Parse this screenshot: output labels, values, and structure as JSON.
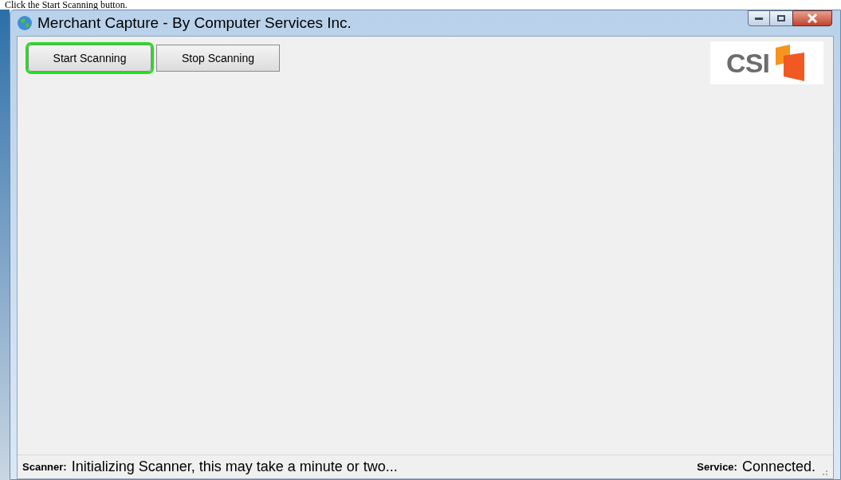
{
  "caption": "Click the Start Scanning button.",
  "window": {
    "title": "Merchant Capture - By Computer Services Inc."
  },
  "toolbar": {
    "buttons": [
      {
        "label": "Start Scanning",
        "highlighted": true
      },
      {
        "label": "Stop Scanning",
        "highlighted": false
      }
    ]
  },
  "logo": {
    "text": "CSI"
  },
  "status_bar": {
    "items": [
      {
        "label": "Scanner:",
        "value": "Initializing Scanner, this may take a minute or two..."
      },
      {
        "label": "Service:",
        "value": "Connected."
      }
    ]
  }
}
